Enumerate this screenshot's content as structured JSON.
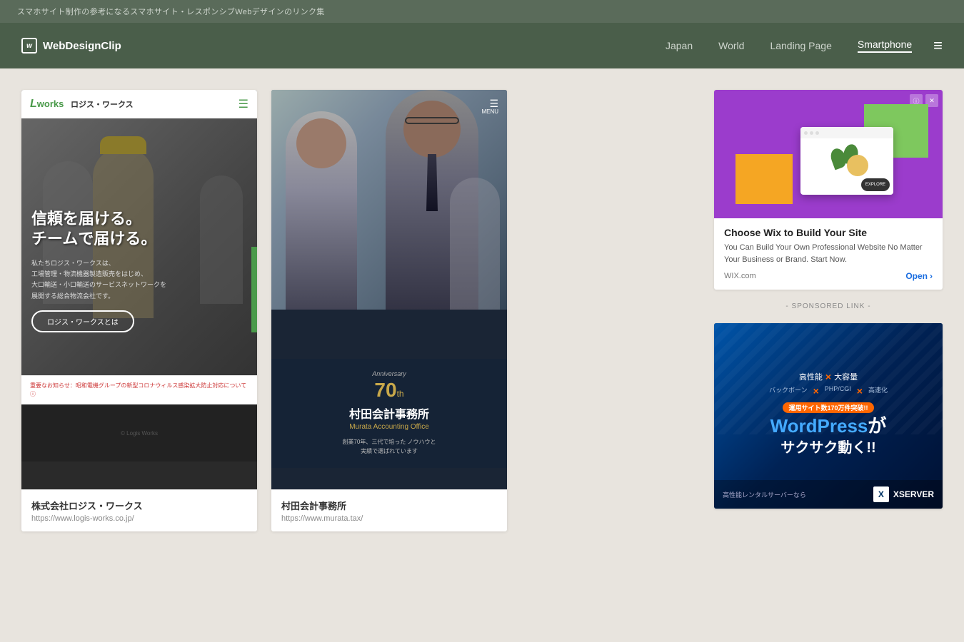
{
  "topBar": {
    "text": "スマホサイト制作の参考になるスマホサイト・レスポンシブWebデザインのリンク集"
  },
  "header": {
    "logo": "WebDesignClip",
    "nav": [
      {
        "label": "Japan",
        "active": false
      },
      {
        "label": "World",
        "active": false
      },
      {
        "label": "Landing Page",
        "active": false
      },
      {
        "label": "Smartphone",
        "active": true
      }
    ],
    "menuIcon": "≡"
  },
  "cards": [
    {
      "title": "株式会社ロジス・ワークス",
      "url": "https://www.logis-works.co.jp/",
      "headline1": "信頼を届ける。",
      "headline2": "チームで届ける。",
      "description": "私たちロジス・ワークスは、\n工場管理・物流機器製造販売をはじめ、\n大口輸送・小口輸送のサービスネットワークを\n展開する総合物流会社です。",
      "buttonLabel": "ロジス・ワークスとは",
      "noticeText": "重要なお知らせ：昭和電機グループの新型コロナウィルス感染拡大防止対応について ⓘ"
    },
    {
      "title": "村田会計事務所",
      "url": "https://www.murata.tax/",
      "anniversaryScript": "Anniversary",
      "anniversaryNumber": "70",
      "anniversarySuffix": "th",
      "companyJP": "村田会計事務所",
      "companyEN": "Murata Accounting Office",
      "desc1": "創業70年、三代で培った ノウハウと",
      "desc2": "実績で選ばれています"
    }
  ],
  "wixAd": {
    "title": "Choose Wix to Build Your Site",
    "description": "You Can Build Your Own Professional Website No Matter Your Business or Brand. Start Now.",
    "domain": "WIX.com",
    "openLabel": "Open",
    "exploreText": "EXPLORE"
  },
  "sponsoredLabel": "- SPONSORED LINK -",
  "xserverAd": {
    "topLine1": "高性能",
    "topLine2": "大容量",
    "topLine3": "バックボーン",
    "topLine4": "PHP/CGI",
    "topLine5": "高速化",
    "crossSymbol": "×",
    "wpText": "WordPress",
    "wpSuffix": "が",
    "subText": "サクサク動く!!",
    "announcement": "運用サイト数170万件突破!!",
    "footerText": "高性能レンタルサーバーなら",
    "logoText": "XSERVER"
  }
}
